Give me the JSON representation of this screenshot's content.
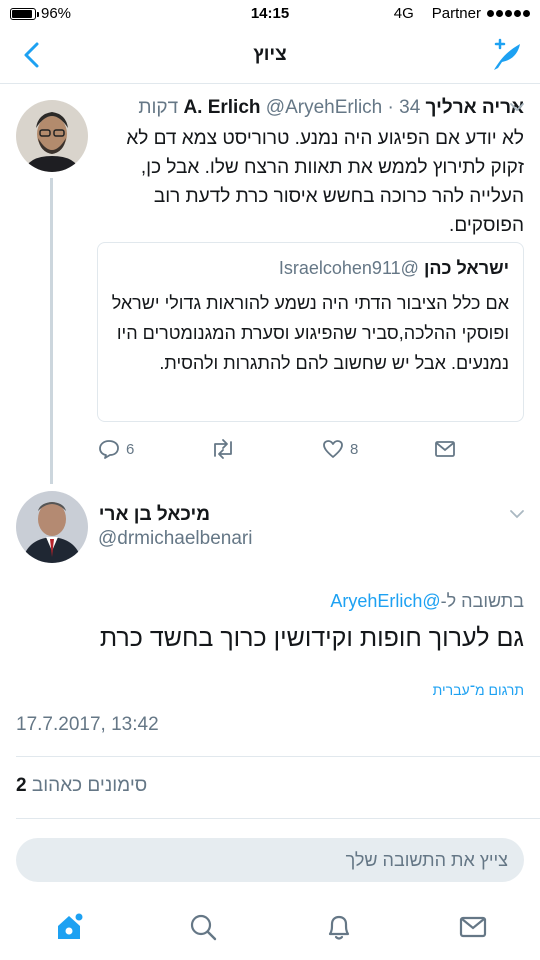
{
  "status_bar": {
    "battery": "96%",
    "time": "14:15",
    "network": "4G",
    "carrier": "Partner"
  },
  "nav": {
    "title": "ציוץ"
  },
  "tweet": {
    "name": "אריה ארליך A. Erlich",
    "handle": "@AryehErlich",
    "time_ago": "34 דקות",
    "text": "לא יודע אם הפיגוע היה נמנע. טרוריסט צמא דם לא זקוק לתירוץ לממש את תאוות הרצח שלו. אבל כן, העלייה להר כרוכה בחשש איסור כרת לדעת רוב הפוסקים.",
    "quote": {
      "name": "ישראל כהן",
      "handle": "@Israelcohen911",
      "text": "אם כלל הציבור הדתי היה נשמע להוראות גדולי ישראל ופוסקי ההלכה,סביר שהפיגוע וסערת המגנומטרים היו נמנעים. אבל יש שחשוב להם להתגרות ולהסית."
    },
    "actions": {
      "replies": "6",
      "likes": "8"
    }
  },
  "reply": {
    "name": "מיכאל בן ארי",
    "handle": "@drmichaelbenari",
    "reply_prefix": "בתשובה ל-",
    "reply_to": "@AryehErlich",
    "text": "גם לערוך חופות וקידושין כרוך בחשד כרת",
    "translate": "תרגום מ־עברית",
    "timestamp": "17.7.2017, 13:42",
    "likes_count": "2",
    "likes_label": "סימונים כאהוב"
  },
  "compose": {
    "placeholder": "צייץ את התשובה שלך"
  },
  "colors": {
    "accent": "#1da1f2",
    "secondary_text": "#657786",
    "divider": "#e1e8ed"
  }
}
